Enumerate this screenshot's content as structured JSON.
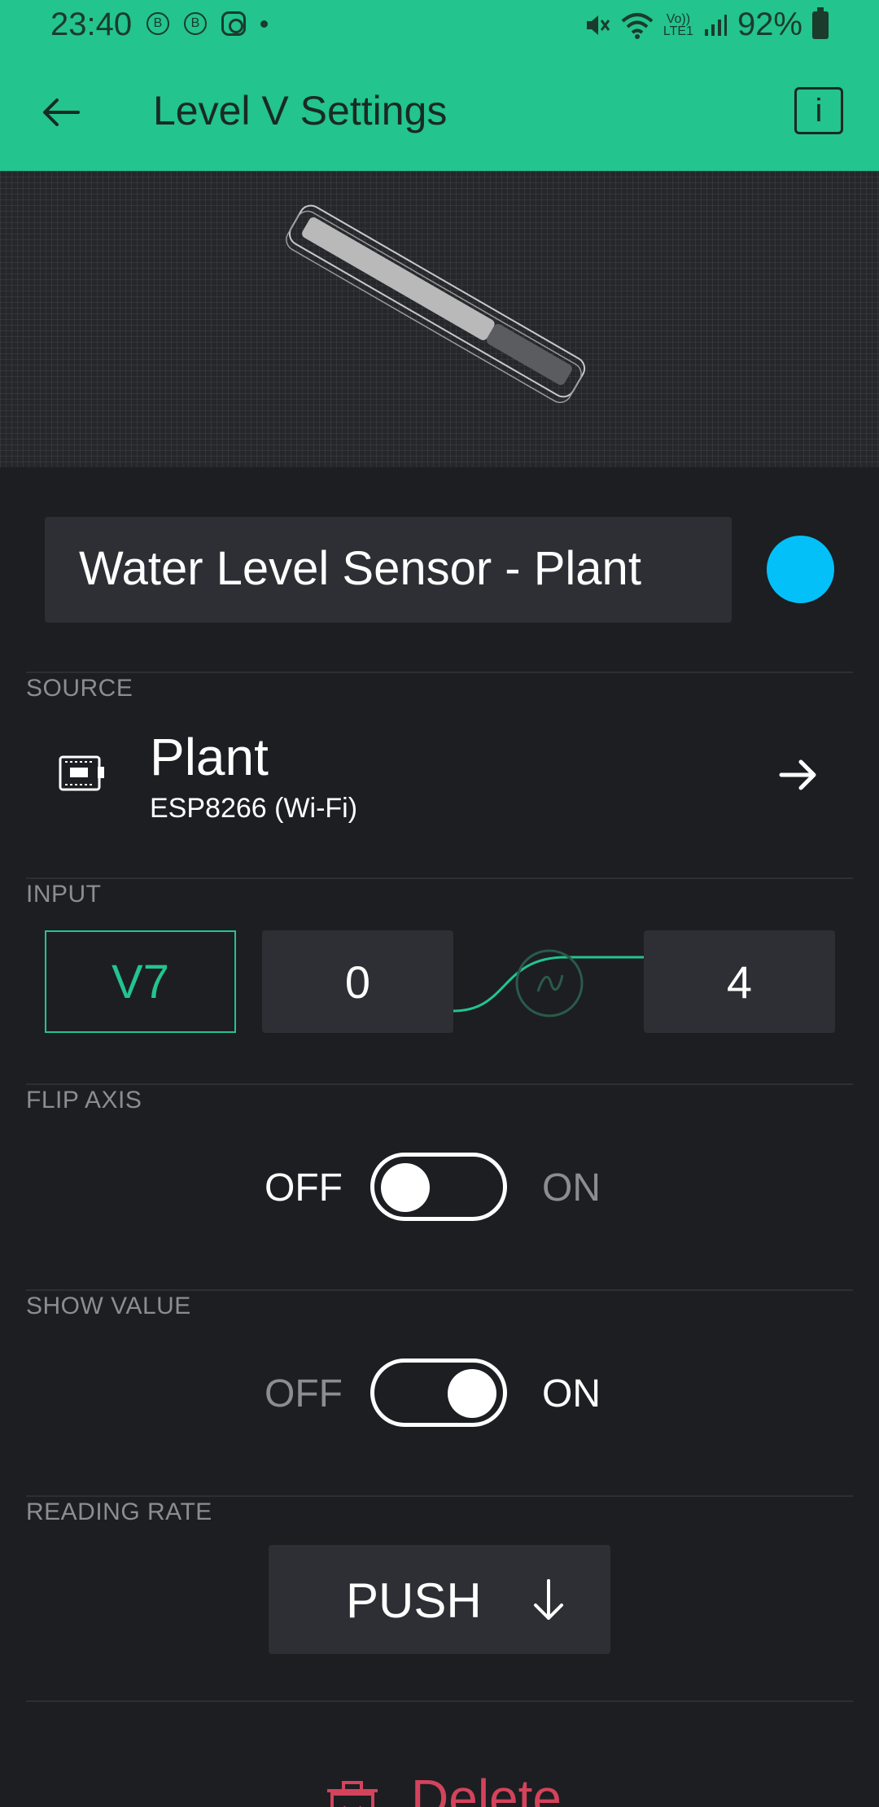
{
  "status_bar": {
    "time": "23:40",
    "left_icons": [
      "bitcoin-icon",
      "bitcoin-icon",
      "instagram-icon",
      "dot-icon"
    ],
    "b_label": "B",
    "network_label_top": "Vo))",
    "network_label_bottom": "LTE1",
    "battery": "92%"
  },
  "app_bar": {
    "title": "Level V Settings",
    "back_icon": "arrow-left-icon",
    "info_label": "i"
  },
  "widget": {
    "name": "Water Level Sensor - Plant",
    "color": "#04c0f8"
  },
  "source": {
    "label": "SOURCE",
    "device_name": "Plant",
    "device_type": "ESP8266 (Wi-Fi)",
    "icon": "device-board-icon"
  },
  "input": {
    "label": "INPUT",
    "pin": "V7",
    "min": "0",
    "max": "4"
  },
  "flip_axis": {
    "label": "FLIP AXIS",
    "off_label": "OFF",
    "on_label": "ON",
    "state": "off"
  },
  "show_value": {
    "label": "SHOW VALUE",
    "off_label": "OFF",
    "on_label": "ON",
    "state": "on"
  },
  "reading_rate": {
    "label": "READING RATE",
    "value": "PUSH"
  },
  "delete": {
    "label": "Delete"
  },
  "colors": {
    "accent": "#23c48e",
    "background": "#1c1e22",
    "field": "#2d2f34",
    "danger": "#d3435c"
  }
}
